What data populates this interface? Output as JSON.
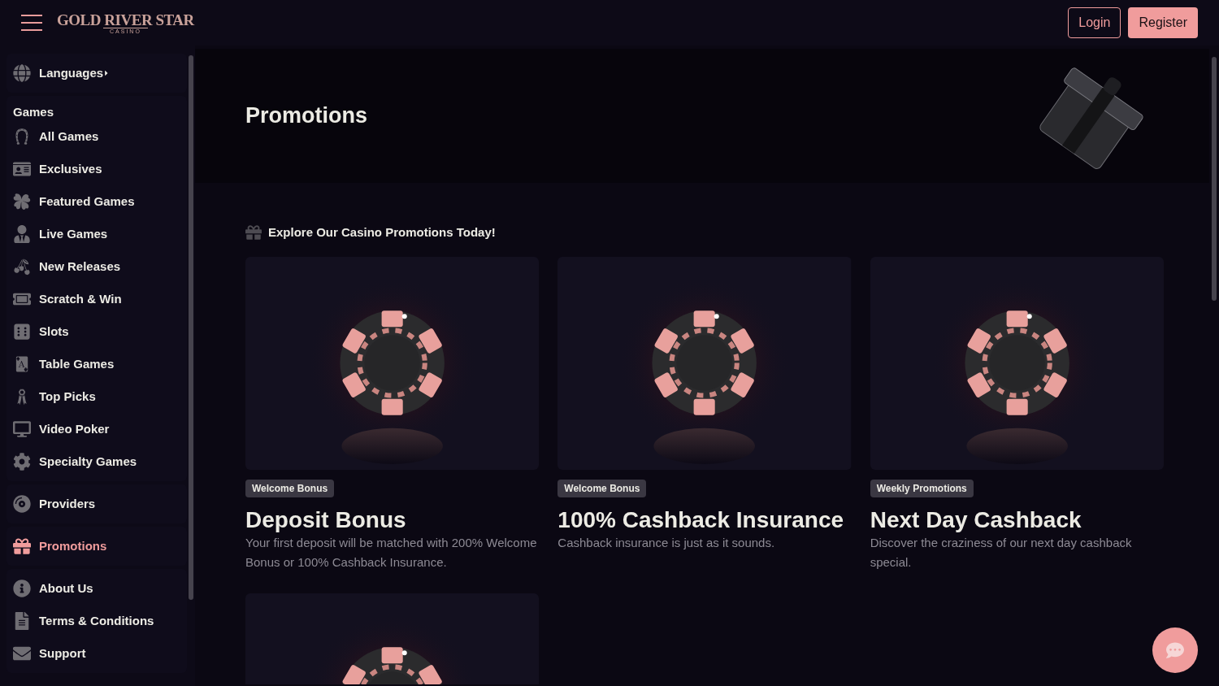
{
  "header": {
    "logo": {
      "title": "GOLD RIVER STAR",
      "subtitle": "CASINO"
    },
    "buttons": [
      {
        "label": "Login",
        "kind": "outline"
      },
      {
        "label": "Register",
        "kind": "filled"
      }
    ]
  },
  "sidebar": {
    "sections": [
      {
        "items": [
          {
            "label": "Languages",
            "selected": false,
            "submenu": true
          }
        ]
      },
      {
        "heading": "Games",
        "items": [
          {
            "label": "All Games",
            "selected": false
          },
          {
            "label": "Exclusives",
            "selected": false
          },
          {
            "label": "Featured Games",
            "selected": false
          },
          {
            "label": "Live Games",
            "selected": false
          },
          {
            "label": "New Releases",
            "selected": false
          },
          {
            "label": "Scratch & Win",
            "selected": false
          },
          {
            "label": "Slots",
            "selected": false
          },
          {
            "label": "Table Games",
            "selected": false
          },
          {
            "label": "Top Picks",
            "selected": false
          },
          {
            "label": "Video Poker",
            "selected": false
          },
          {
            "label": "Specialty Games",
            "selected": false
          }
        ]
      },
      {
        "items": [
          {
            "label": "Providers",
            "selected": false
          }
        ]
      },
      {
        "items": [
          {
            "label": "Promotions",
            "selected": true
          }
        ]
      },
      {
        "items": [
          {
            "label": "About Us",
            "selected": false
          },
          {
            "label": "Terms & Conditions",
            "selected": false
          },
          {
            "label": "Support",
            "selected": false
          }
        ]
      }
    ]
  },
  "hero": {
    "title": "Promotions"
  },
  "section_heading": "Explore Our Casino Promotions Today!",
  "promotions": [
    {
      "kind": "promo",
      "tag": "Welcome Bonus",
      "title": "Deposit Bonus",
      "description": "Your first deposit will be matched with 200% Welcome Bonus or 100% Cashback Insurance."
    },
    {
      "kind": "promo",
      "tag": "Welcome Bonus",
      "title": "100% Cashback Insurance",
      "description": "Cashback insurance is just as it sounds."
    },
    {
      "kind": "promo",
      "tag": "Weekly Promotions",
      "title": "Next Day Cashback",
      "description": "Discover the craziness of our next day cashback special."
    },
    {
      "kind": "picture"
    }
  ]
}
